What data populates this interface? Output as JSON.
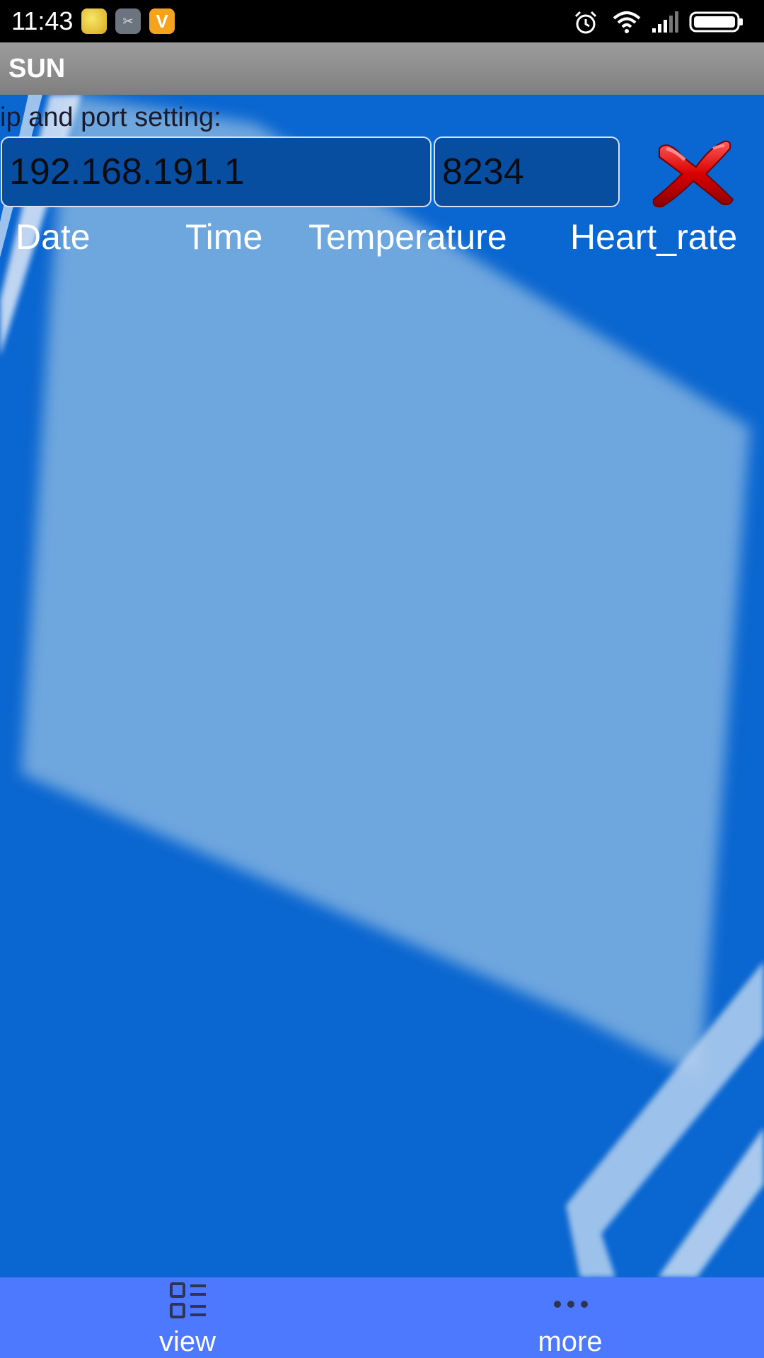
{
  "status_bar": {
    "time": "11:43",
    "notification_icons": [
      "lemon-app-icon",
      "scissors-app-icon",
      "v-app-icon"
    ],
    "v_icon_letter": "V",
    "system_icons": [
      "alarm-icon",
      "wifi-icon",
      "signal-icon",
      "battery-icon"
    ]
  },
  "app": {
    "title": "SUN"
  },
  "settings": {
    "label": "ip and port setting:",
    "ip_value": "192.168.191.1",
    "port_value": "8234",
    "close_icon": "close-icon",
    "close_color": "#d40000"
  },
  "table": {
    "headers": [
      "Date",
      "Time",
      "Temperature",
      "Heart_rate"
    ]
  },
  "bottom_nav": {
    "items": [
      {
        "label": "view",
        "icon": "list-icon"
      },
      {
        "label": "more",
        "icon": "more-dots-icon"
      }
    ]
  },
  "colors": {
    "background": "#0a66d0",
    "title_bar": "#8a8a8a",
    "bottom_nav": "#4c79ff"
  }
}
